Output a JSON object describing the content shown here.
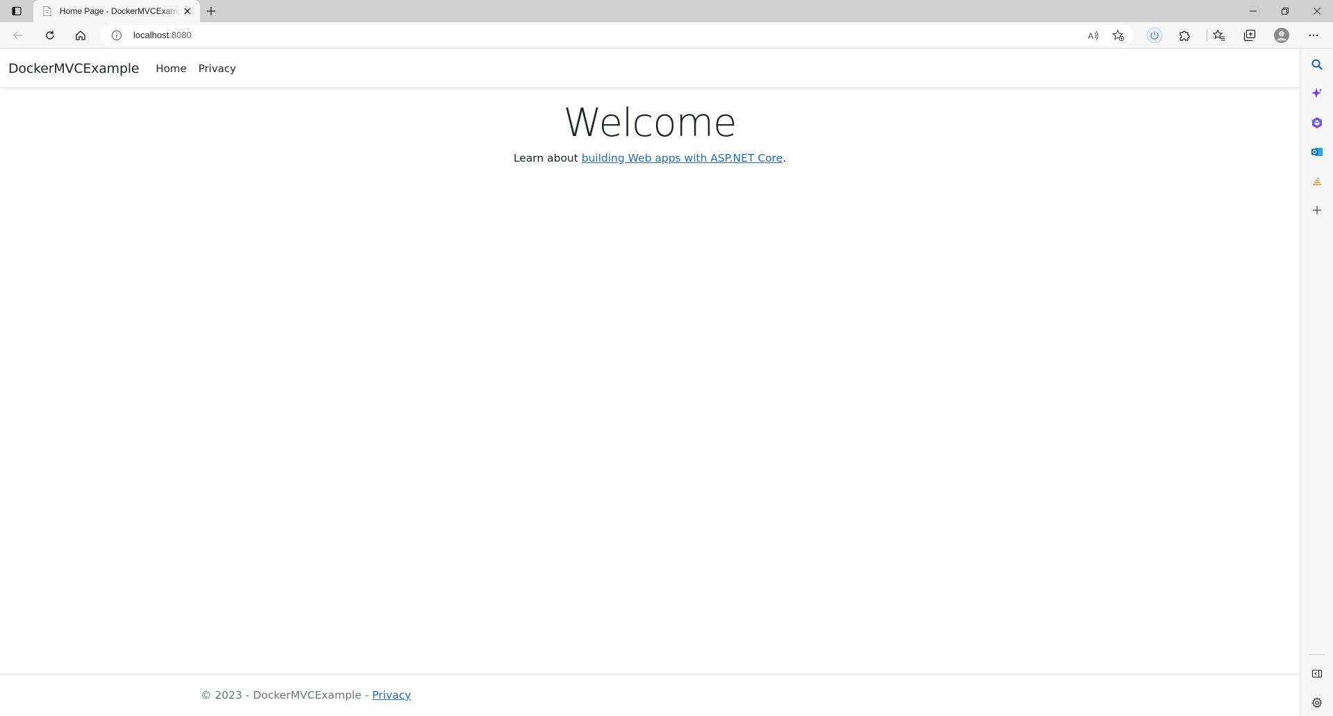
{
  "browser": {
    "tab_title": "Home Page - DockerMVCExample",
    "url_host": "localhost",
    "url_port": ":8080"
  },
  "site": {
    "brand": "DockerMVCExample",
    "nav": [
      {
        "label": "Home"
      },
      {
        "label": "Privacy"
      }
    ]
  },
  "main": {
    "heading": "Welcome",
    "learn_prefix": "Learn about ",
    "learn_link": "building Web apps with ASP.NET Core",
    "learn_suffix": "."
  },
  "footer": {
    "copyright": "© 2023 - DockerMVCExample - ",
    "privacy_link": "Privacy"
  },
  "colors": {
    "link": "#1b6ec2",
    "text": "#212529",
    "muted": "#6c757d",
    "chrome_tabbar": "#cfcfcf",
    "chrome_toolbar": "#f7f7f7"
  },
  "icons": {
    "tab_actions": "tab-actions-icon",
    "favicon": "page-favicon-icon",
    "close_tab": "close-icon",
    "new_tab": "plus-icon",
    "minimize": "minimize-icon",
    "restore": "restore-icon",
    "close_window": "close-icon",
    "back": "back-arrow-icon",
    "refresh": "refresh-icon",
    "home": "home-icon",
    "site_info": "info-icon",
    "read_aloud": "read-aloud-icon",
    "add_favorite": "star-plus-icon",
    "power": "power-icon",
    "extensions": "puzzle-icon",
    "favorites": "favorites-icon",
    "collections": "collections-icon",
    "profile": "profile-avatar-icon",
    "more": "more-icon",
    "sidebar": [
      "search-icon",
      "copilot-icon",
      "office-icon",
      "outlook-icon",
      "tools-icon",
      "plus-icon",
      "sidebar-toggle-icon",
      "settings-icon"
    ]
  }
}
